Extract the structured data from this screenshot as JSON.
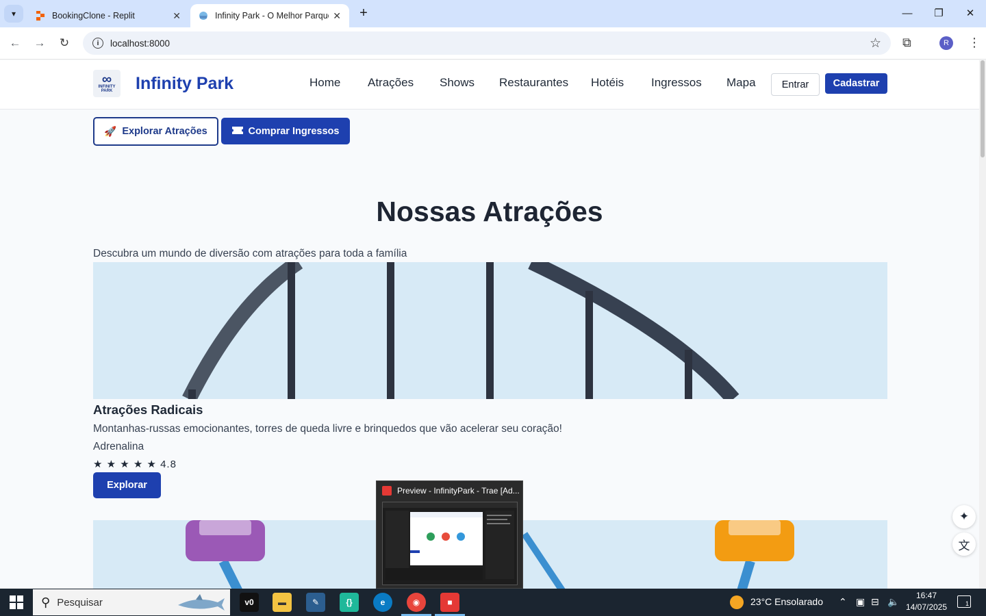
{
  "browser": {
    "tabs": [
      {
        "title": "BookingClone - Replit",
        "active": false
      },
      {
        "title": "Infinity Park - O Melhor Parque",
        "active": true
      }
    ],
    "url": "localhost:8000",
    "profile_initial": "R"
  },
  "site": {
    "logo_text": "INFINITY PARK",
    "brand": "Infinity Park",
    "nav": [
      "Home",
      "Atrações",
      "Shows",
      "Restaurantes",
      "Hotéis",
      "Ingressos",
      "Mapa"
    ],
    "login_label": "Entrar",
    "signup_label": "Cadastrar"
  },
  "hero": {
    "explore_label": "Explorar Atrações",
    "buy_label": "Comprar Ingressos"
  },
  "section": {
    "title": "Nossas Atrações",
    "subtitle": "Descubra um mundo de diversão com atrações para toda a família"
  },
  "cards": [
    {
      "title": "Atrações Radicais",
      "description": "Montanhas-russas emocionantes, torres de queda livre e brinquedos que vão acelerar seu coração!",
      "tag": "Adrenalina",
      "stars": "★ ★ ★ ★ ★",
      "rating": "4.8",
      "button": "Explorar"
    }
  ],
  "taskbar": {
    "search_placeholder": "Pesquisar",
    "preview_title": "Preview - InfinityPark - Trae [Ad...",
    "weather": "23°C  Ensolarado",
    "time": "16:47",
    "date": "14/07/2025",
    "notification_count": "1"
  },
  "colors": {
    "primary": "#1e40af",
    "card_bg": "#d7eaf6",
    "taskbar": "#1b2530"
  }
}
